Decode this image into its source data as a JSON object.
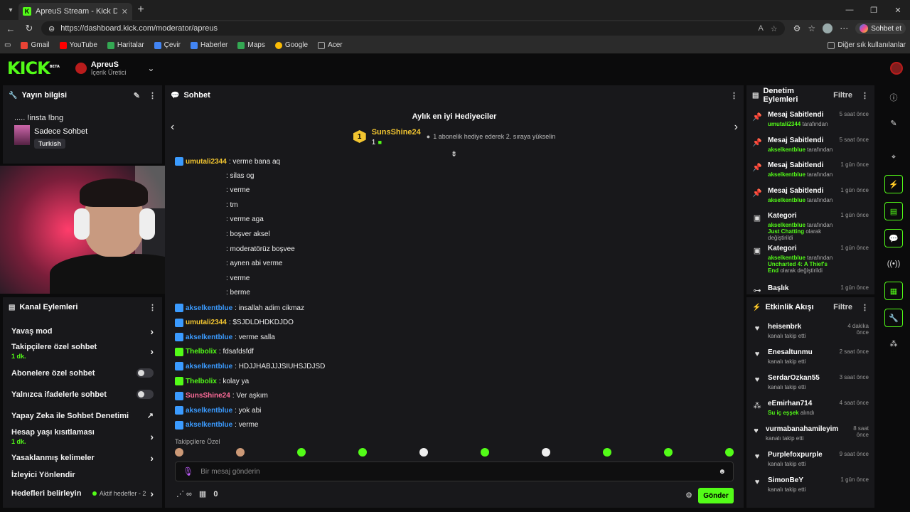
{
  "browser": {
    "tab_title": "ApreuS Stream - Kick Dashboard",
    "url": "https://dashboard.kick.com/moderator/apreus",
    "copilot_label": "Sohbet et",
    "bookmarks": [
      "Gmail",
      "YouTube",
      "Haritalar",
      "Çevir",
      "Haberler",
      "Maps",
      "Google",
      "Acer"
    ],
    "bookmark_colors": [
      "#ea4335",
      "#ff0000",
      "#34a853",
      "#4285f4",
      "#4285f4",
      "#34a853",
      "#fbbc05",
      "#aaaaaa"
    ],
    "other_bookmarks": "Diğer sık kullanılanlar"
  },
  "header": {
    "logo": "KICK",
    "logo_badge": "BETA",
    "channel_name": "ApreuS",
    "channel_role": "İçerik Üretici"
  },
  "stream_info": {
    "title": "Yayın bilgisi",
    "stream_title": "..... !insta !bng",
    "category": "Sadece Sohbet",
    "tag": "Turkish"
  },
  "channel_actions": {
    "title": "Kanal Eylemleri",
    "items": [
      {
        "label": "Yavaş mod"
      },
      {
        "label": "Takipçilere özel sohbet",
        "sub": "1 dk."
      },
      {
        "label": "Abonelere özel sohbet"
      },
      {
        "label": "Yalnızca ifadelerle sohbet"
      },
      {
        "label": "Yapay Zeka ile Sohbet Denetimi"
      },
      {
        "label": "Hesap yaşı kısıtlaması",
        "sub": "1 dk."
      },
      {
        "label": "Yasaklanmış kelimeler"
      },
      {
        "label": "İzleyici Yönlendir"
      },
      {
        "label": "Hedefleri belirleyin",
        "goal": "Aktif hedefler - 2"
      }
    ]
  },
  "chat": {
    "title": "Sohbet",
    "gifters_title": "Aylık en iyi Hediyeciler",
    "gifter_rank": "1",
    "gifter_name": "SunsShine24",
    "gifter_count": "1",
    "gifter_message": "1 abonelik hediye ederek 2. sıraya yükselin",
    "messages": [
      {
        "user": "umutali2344",
        "color": "orange",
        "text": ": verme bana aq"
      },
      {
        "user": "",
        "color": "",
        "text": ": silas og"
      },
      {
        "user": "",
        "color": "",
        "text": ": verme"
      },
      {
        "user": "",
        "color": "",
        "text": ": tm"
      },
      {
        "user": "",
        "color": "",
        "text": ": verme aga"
      },
      {
        "user": "",
        "color": "",
        "text": ": boşver aksel"
      },
      {
        "user": "",
        "color": "",
        "text": ": moderatörüz boşvee"
      },
      {
        "user": "",
        "color": "",
        "text": ": aynen abi verme"
      },
      {
        "user": "",
        "color": "",
        "text": ": verme"
      },
      {
        "user": "",
        "color": "",
        "text": ": berme"
      },
      {
        "user": "akselkentblue",
        "color": "blue",
        "text": ": insallah adim cikmaz"
      },
      {
        "user": "umutali2344",
        "color": "orange",
        "text": ": $SJDLDHDKDJDO"
      },
      {
        "user": "akselkentblue",
        "color": "blue",
        "text": ": verme salla"
      },
      {
        "user": "Thelbolix",
        "color": "green",
        "text": ": fdsafdsfdf"
      },
      {
        "user": "akselkentblue",
        "color": "blue",
        "text": ": HDJJHABJJJSIUHSJDJSD"
      },
      {
        "user": "Thelbolix",
        "color": "green",
        "text": ": kolay ya"
      },
      {
        "user": "SunsShine24",
        "color": "pink",
        "text": ": Ver aşkım"
      },
      {
        "user": "akselkentblue",
        "color": "blue",
        "text": ": yok abi"
      },
      {
        "user": "akselkentblue",
        "color": "blue",
        "text": ": verme"
      }
    ],
    "emote_label": "Takipçilere Özel",
    "input_placeholder": "Bir mesaj gönderin",
    "points": "0",
    "send_label": "Gönder"
  },
  "mod_actions": {
    "title": "Denetim Eylemleri",
    "filter": "Filtre",
    "items": [
      {
        "icon": "pin-icon",
        "title": "Mesaj Sabitlendi",
        "user": "umutali2344",
        "suffix": "tarafından",
        "time": "5 saat önce"
      },
      {
        "icon": "pin-icon",
        "title": "Mesaj Sabitlendi",
        "user": "akselkentblue",
        "suffix": "tarafından",
        "time": "5 saat önce"
      },
      {
        "icon": "pin-icon",
        "title": "Mesaj Sabitlendi",
        "user": "akselkentblue",
        "suffix": "tarafından",
        "time": "1 gün önce"
      },
      {
        "icon": "pin-icon",
        "title": "Mesaj Sabitlendi",
        "user": "akselkentblue",
        "suffix": "tarafından",
        "time": "1 gün önce"
      },
      {
        "icon": "category-icon",
        "title": "Kategori",
        "user": "akselkentblue",
        "suffix": "tarafından",
        "extra": "Just Chatting",
        "extra_suffix": "olarak değiştirildi",
        "time": "1 gün önce"
      },
      {
        "icon": "category-icon",
        "title": "Kategori",
        "user": "akselkentblue",
        "suffix": "tarafından",
        "extra": "Uncharted 4: A Thief's End",
        "extra_suffix": "olarak değiştirildi",
        "time": "1 gün önce"
      },
      {
        "icon": "title-icon",
        "title": "Başlık",
        "user": "",
        "suffix": "",
        "time": "1 gün önce"
      }
    ]
  },
  "activity": {
    "title": "Etkinlik Akışı",
    "filter": "Filtre",
    "items": [
      {
        "user": "heisenbrk",
        "desc": "kanalı takip etti",
        "time": "4 dakika önce"
      },
      {
        "user": "Enesaltunmu",
        "desc": "kanalı takip etti",
        "time": "2 saat önce"
      },
      {
        "user": "SerdarOzkan55",
        "desc": "kanalı takip etti",
        "time": "3 saat önce"
      },
      {
        "user": "eEmirhan714",
        "desc": "alındı",
        "highlight": "Su iç eşşek",
        "time": "4 saat önce"
      },
      {
        "user": "vurmabanahamileyim",
        "desc": "kanalı takip etti",
        "time": "8 saat önce"
      },
      {
        "user": "Purplefoxpurple",
        "desc": "kanalı takip etti",
        "time": "9 saat önce"
      },
      {
        "user": "SimonBeY",
        "desc": "kanalı takip etti",
        "time": "1 gün önce"
      }
    ]
  }
}
